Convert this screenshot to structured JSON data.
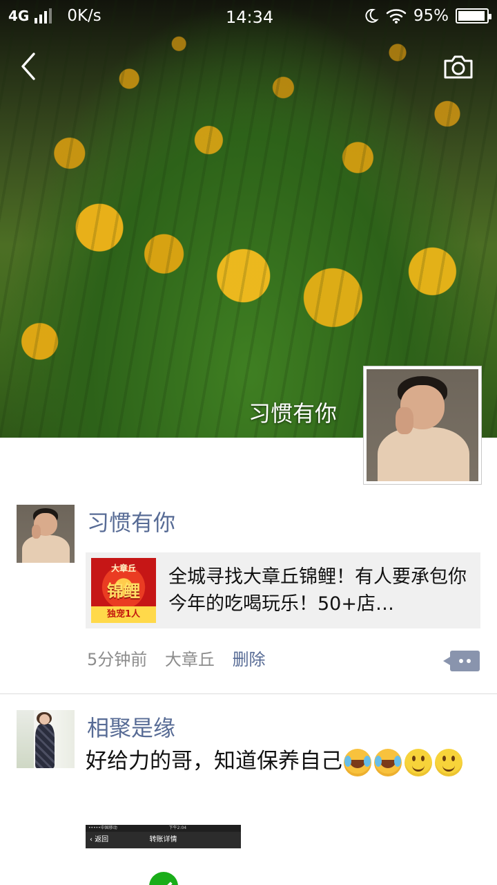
{
  "status_bar": {
    "network": "4G",
    "speed": "0K/s",
    "time": "14:34",
    "battery": "95%",
    "battery_level": 0.95
  },
  "header": {
    "back_icon": "chevron-left-icon",
    "camera_icon": "camera-icon"
  },
  "cover": {
    "name": "习惯有你"
  },
  "posts": [
    {
      "author": "习惯有你",
      "card": {
        "thumb_top": "大章丘",
        "thumb_main": "锦鲤",
        "thumb_bottom": "独宠1人",
        "text": "全城寻找大章丘锦鲤！有人要承包你今年的吃喝玩乐！50+店…"
      },
      "time": "5分钟前",
      "location": "大章丘",
      "delete": "删除"
    },
    {
      "author": "相聚是缘",
      "text": "好给力的哥，知道保养自己",
      "emojis": [
        "laughing-crying-emoji",
        "laughing-crying-emoji",
        "smile-emoji",
        "smile-emoji"
      ],
      "screenshot": {
        "status": "•••••中国移动",
        "status_time": "下午2:04",
        "back": "返回",
        "title": "转账详情"
      }
    }
  ]
}
